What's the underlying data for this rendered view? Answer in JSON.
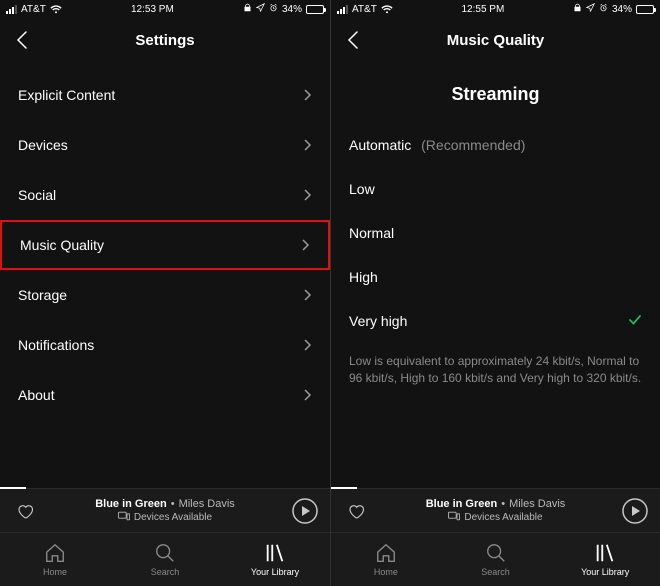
{
  "left": {
    "status": {
      "carrier": "AT&T",
      "time": "12:53 PM",
      "battery": "34%"
    },
    "header": {
      "title": "Settings"
    },
    "items": [
      {
        "label": "Explicit Content"
      },
      {
        "label": "Devices"
      },
      {
        "label": "Social"
      },
      {
        "label": "Music Quality"
      },
      {
        "label": "Storage"
      },
      {
        "label": "Notifications"
      },
      {
        "label": "About"
      }
    ],
    "now_playing": {
      "song": "Blue in Green",
      "artist": "Miles Davis",
      "devices": "Devices Available"
    },
    "tabs": {
      "home": "Home",
      "search": "Search",
      "library": "Your Library"
    }
  },
  "right": {
    "status": {
      "carrier": "AT&T",
      "time": "12:55 PM",
      "battery": "34%"
    },
    "header": {
      "title": "Music Quality"
    },
    "section": "Streaming",
    "options": [
      {
        "label": "Automatic",
        "recommended": "(Recommended)"
      },
      {
        "label": "Low"
      },
      {
        "label": "Normal"
      },
      {
        "label": "High"
      },
      {
        "label": "Very high",
        "selected": true
      }
    ],
    "note": "Low is equivalent to approximately 24 kbit/s, Normal to 96 kbit/s, High to 160 kbit/s and Very high to 320 kbit/s.",
    "now_playing": {
      "song": "Blue in Green",
      "artist": "Miles Davis",
      "devices": "Devices Available"
    },
    "tabs": {
      "home": "Home",
      "search": "Search",
      "library": "Your Library"
    }
  }
}
